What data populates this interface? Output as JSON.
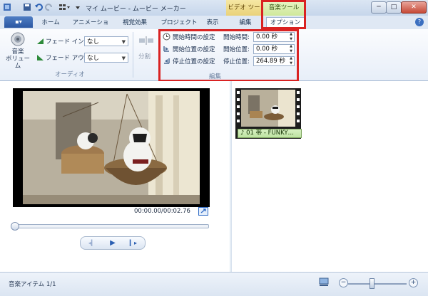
{
  "window": {
    "title": "マイ ムービー - ムービー メーカー",
    "context_groups": {
      "video": "ビデオ ツール",
      "music": "音楽ツール"
    },
    "controls": {
      "minimize": "─",
      "maximize": "□",
      "close": "✕"
    }
  },
  "quick_access": [
    "save-icon",
    "undo-icon",
    "redo-icon",
    "layout-icon"
  ],
  "tabs": {
    "file_menu": "▪▾",
    "items": [
      "ホーム",
      "アニメーション",
      "視覚効果",
      "プロジェクト",
      "表示",
      "編集",
      "オプション"
    ],
    "active": "オプション",
    "help": "?"
  },
  "ribbon": {
    "audio": {
      "volume_label": "音楽\nボリューム",
      "fade_in_label": "フェード イン:",
      "fade_in_value": "なし",
      "fade_out_label": "フェード アウト:",
      "fade_out_value": "なし",
      "group_label": "オーディオ"
    },
    "split": {
      "label": "分割"
    },
    "edit": {
      "set_start_time": "開始時間の設定",
      "set_start_point": "開始位置の設定",
      "set_end_point": "停止位置の設定",
      "start_time_label": "開始時間:",
      "start_time_value": "0.00 秒",
      "start_point_label": "開始位置:",
      "start_point_value": "0.00 秒",
      "end_point_label": "停止位置:",
      "end_point_value": "264.89 秒",
      "group_label": "編集"
    }
  },
  "preview": {
    "timecode": "00:00.00/00:02.76",
    "transport": {
      "prev": "◂▎",
      "play": "▶",
      "next": "▎▸"
    }
  },
  "storyboard": {
    "clip_label": "♪ 01 帯 - FUNKY…"
  },
  "status": {
    "text": "音楽アイテム 1/1",
    "zoom_out": "−",
    "zoom_in": "+"
  },
  "colors": {
    "highlight": "#d92222",
    "ribbon_blue": "#2b57a2",
    "music_green": "#bde3a1"
  }
}
